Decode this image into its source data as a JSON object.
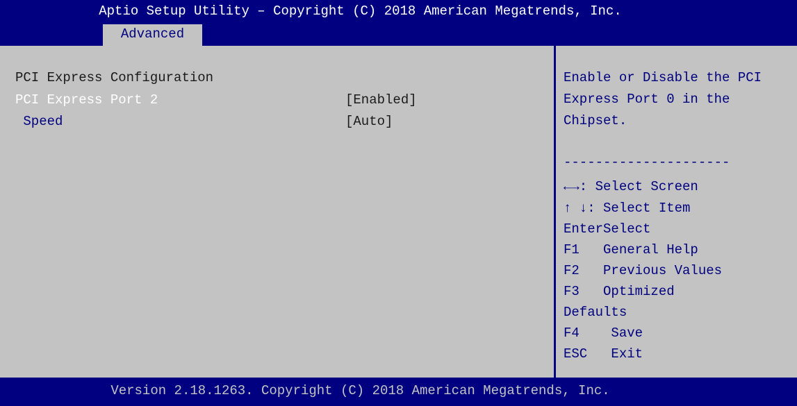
{
  "header": {
    "title": "Aptio Setup Utility – Copyright (C) 2018 American Megatrends, Inc.",
    "active_tab": "Advanced"
  },
  "main": {
    "section_title": "PCI Express Configuration",
    "items": [
      {
        "label": "PCI Express Port 2",
        "value": "[Enabled]"
      },
      {
        "label": " Speed",
        "value": "[Auto]"
      }
    ]
  },
  "help": {
    "description": [
      "Enable or Disable the PCI",
      "Express Port 0 in the",
      "Chipset."
    ],
    "separator": "---------------------",
    "keys": [
      "←→: Select Screen",
      "↑ ↓: Select Item",
      "EnterSelect",
      "F1   General Help",
      "F2   Previous Values",
      "F3   Optimized",
      "Defaults",
      "F4    Save",
      "ESC   Exit"
    ]
  },
  "footer": {
    "version": "Version 2.18.1263. Copyright (C) 2018 American Megatrends, Inc."
  }
}
